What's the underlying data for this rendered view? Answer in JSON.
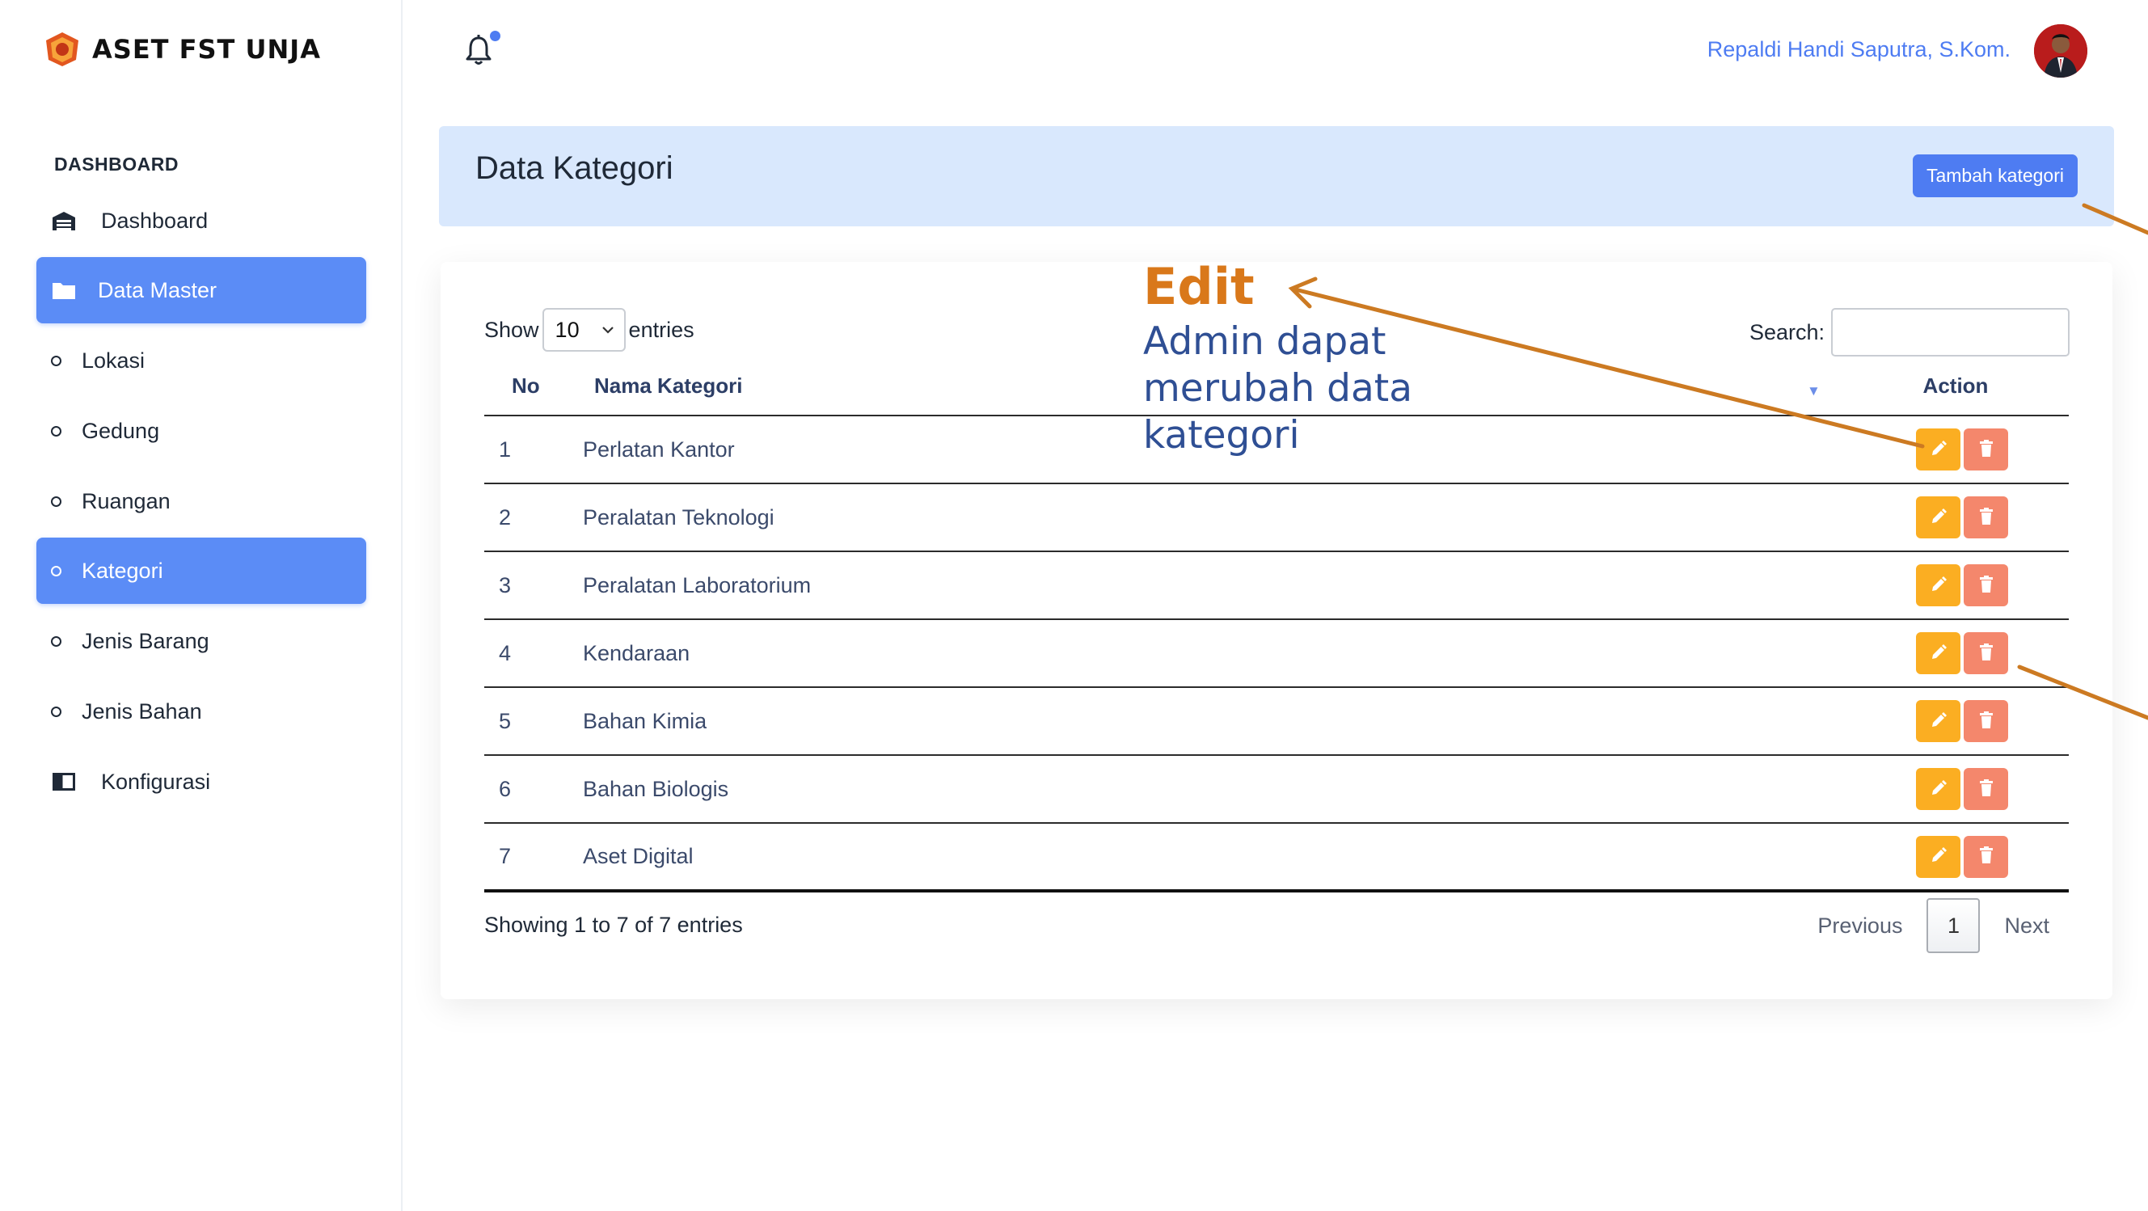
{
  "brand": {
    "name": "ASET FST UNJA"
  },
  "sidebar": {
    "section_title": "DASHBOARD",
    "items": [
      {
        "label": "Dashboard",
        "icon": "warehouse-icon",
        "active": false
      },
      {
        "label": "Data Master",
        "icon": "folder-icon",
        "active": true
      },
      {
        "label": "Lokasi",
        "icon": "bullet",
        "active": false
      },
      {
        "label": "Gedung",
        "icon": "bullet",
        "active": false
      },
      {
        "label": "Ruangan",
        "icon": "bullet",
        "active": false
      },
      {
        "label": "Kategori",
        "icon": "bullet",
        "active": true
      },
      {
        "label": "Jenis Barang",
        "icon": "bullet",
        "active": false
      },
      {
        "label": "Jenis Bahan",
        "icon": "bullet",
        "active": false
      },
      {
        "label": "Konfigurasi",
        "icon": "columns-icon",
        "active": false
      }
    ]
  },
  "topbar": {
    "user_name": "Repaldi Handi Saputra, S.Kom.",
    "notification_icon": "bell-icon"
  },
  "header": {
    "title": "Data Kategori",
    "add_button_label": "Tambah kategori"
  },
  "table": {
    "length_label_before": "Show",
    "length_value": "10",
    "length_label_after": "entries",
    "search_label": "Search:",
    "columns": [
      "No",
      "Nama Kategori",
      "Action"
    ],
    "rows": [
      {
        "no": "1",
        "name": "Perlatan Kantor"
      },
      {
        "no": "2",
        "name": "Peralatan Teknologi"
      },
      {
        "no": "3",
        "name": "Peralatan Laboratorium"
      },
      {
        "no": "4",
        "name": "Kendaraan"
      },
      {
        "no": "5",
        "name": "Bahan Kimia"
      },
      {
        "no": "6",
        "name": "Bahan Biologis"
      },
      {
        "no": "7",
        "name": "Aset Digital"
      }
    ],
    "info": "Showing 1 to 7 of 7 entries",
    "pagination": {
      "previous": "Previous",
      "current": "1",
      "next": "Next"
    }
  },
  "annotation": {
    "title": "Edit",
    "body": "Admin dapat merubah data kategori"
  },
  "colors": {
    "accent": "#5b8cf6",
    "header_bg": "#d9e8fd",
    "edit_button": "#fbae22",
    "delete_button": "#f4876c",
    "annotation_title": "#d9781a",
    "annotation_body": "#2f4f94",
    "arrow": "#cc7a22"
  }
}
